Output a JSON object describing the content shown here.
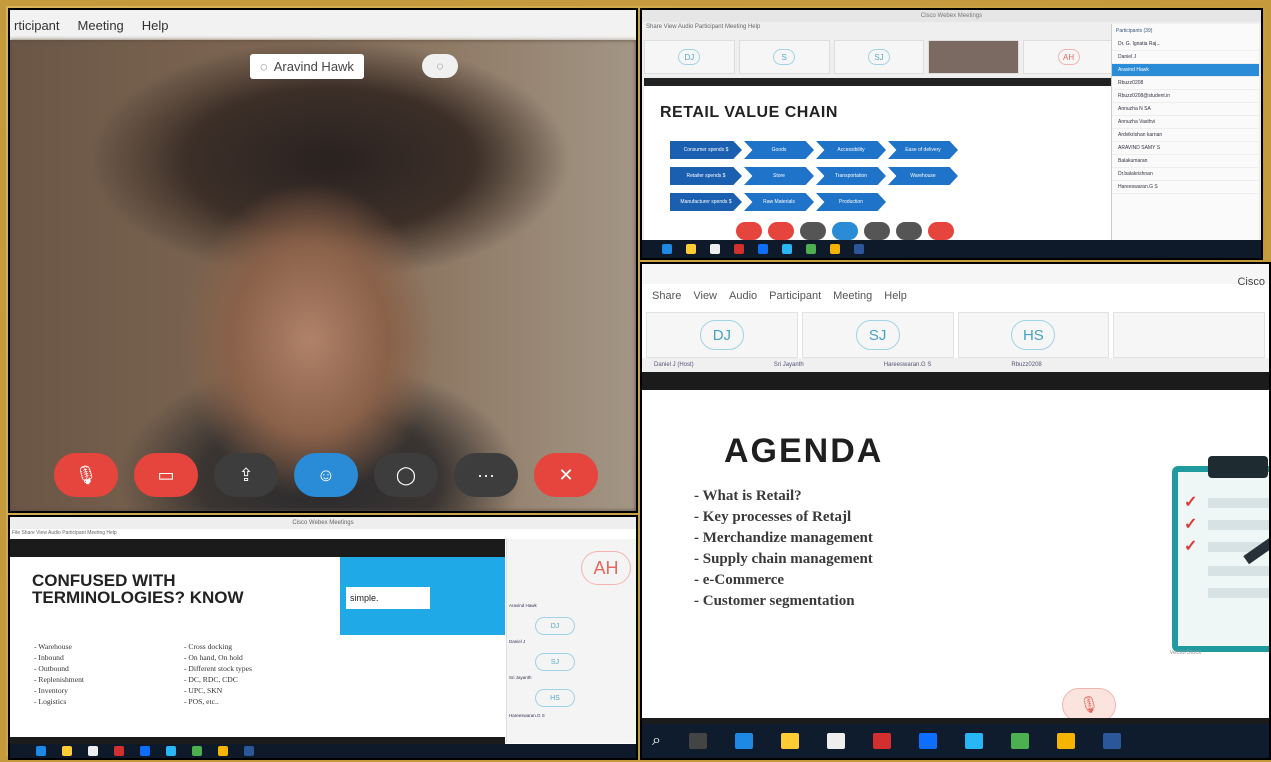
{
  "panelA": {
    "menu": [
      "rticipant",
      "Meeting",
      "Help"
    ],
    "name_tag": "Aravind Hawk",
    "controls": [
      "mute-mic",
      "stop-video",
      "share",
      "participants",
      "chat",
      "more",
      "leave"
    ]
  },
  "panelB": {
    "window_title": "Cisco Webex Meetings",
    "menu": "Share  View  Audio  Participant  Meeting  Help",
    "thumbs": [
      "DJ",
      "S",
      "SJ",
      "",
      "AH"
    ],
    "slide_title": "RETAIL VALUE CHAIN",
    "chain": [
      [
        "Consumer spends $",
        "Goods",
        "Accessibility",
        "Ease of delivery"
      ],
      [
        "Retailer spends $",
        "Store",
        "Transportation",
        "Warehouse"
      ],
      [
        "Manufacturer spends $",
        "Raw Materials",
        "Production"
      ]
    ],
    "participants_header": "Participants (39)",
    "participants": [
      "Dr. G. Ignatia Raj...",
      "Daniel J",
      "Aravind Hawk",
      "Rbuzz0208",
      "Rbuzz0208@student.in",
      "Annuzha N SA",
      "Annuzha Vasthvi",
      "Ardvikrishan karnan",
      "ARAVIND SAMY S",
      "Balakumaran",
      "Dr.balakrishnan",
      "Hareeswaran.G S"
    ]
  },
  "panelC": {
    "window_title": "Cisco Webex Meetings",
    "menu": "File  Share  View  Audio  Participant  Meeting  Help",
    "slide_title_line1": "CONFUSED WITH",
    "slide_title_line2": "TERMINOLOGIES? KNOW",
    "paper_text": "simple.",
    "col1": [
      "- Warehouse",
      "- Inbound",
      "- Outbound",
      "- Replenishment",
      "- Inventory",
      "- Logistics"
    ],
    "col2": [
      "- Cross docking",
      "- On hand, On hold",
      "- Different stock types",
      "- DC, RDC, CDC",
      "- UPC, SKN",
      "- POS, etc.."
    ],
    "side_avatar": "AH",
    "side_names": [
      "Aravind Hawk",
      "Daniel J",
      "Sri Jayanth",
      "Hareeswaran.G S"
    ],
    "side_minis": [
      "DJ",
      "SJ",
      "HS"
    ]
  },
  "panelD": {
    "app_name": "Cisco",
    "menu": [
      "Share",
      "View",
      "Audio",
      "Participant",
      "Meeting",
      "Help"
    ],
    "thumbs": [
      "DJ",
      "SJ",
      "HS"
    ],
    "names": [
      "Daniel J (Host)",
      "Sri Jayanth",
      "Hareeswaran.G S",
      "Rbuzz0208"
    ],
    "slide_title": "AGENDA",
    "agenda": [
      "What is Retail?",
      "Key processes of Retajl",
      "Merchandize management",
      "Supply chain management",
      "e-Commerce",
      "Customer segmentation"
    ],
    "watermark": "vectorStock"
  },
  "colors": {
    "accent_blue": "#2a8bd6",
    "alert_red": "#e5453d",
    "frame_gold": "#c49a3c",
    "teal": "#1f9ba0"
  }
}
